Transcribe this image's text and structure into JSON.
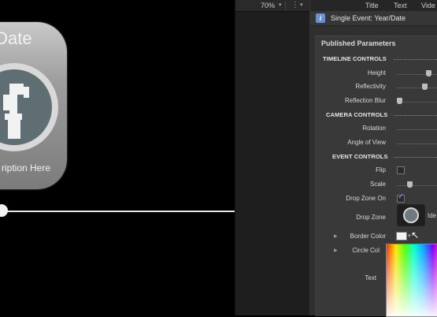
{
  "viewer": {
    "card_title": "/Date",
    "card_description": "ription Here"
  },
  "toolbar": {
    "zoom": "70%",
    "zoom_caret": "▾",
    "view_options_glyph": "⋮",
    "view_options_caret": "▾"
  },
  "inspector": {
    "tabs": [
      "Title",
      "Text",
      "Vide"
    ],
    "header_title": "Single Event: Year/Date",
    "panel_title": "Published Parameters",
    "sections": {
      "timeline": "TIMELINE CONTROLS",
      "camera": "CAMERA CONTROLS",
      "event": "EVENT CONTROLS"
    },
    "params": {
      "height": "Height",
      "reflectivity": "Reflectivity",
      "reflection_blur": "Reflection Blur",
      "rotation": "Rotation",
      "angle_of_view": "Angle of View",
      "flip": "Flip",
      "scale": "Scale",
      "drop_zone_on": "Drop Zone On",
      "drop_zone": "Drop Zone",
      "drop_zone_right": "Ide",
      "border_color": "Border Color",
      "circle_color": "Circle Col",
      "text_label": "Text"
    },
    "values": {
      "flip_checked": false,
      "drop_zone_on_checked": true
    }
  },
  "icons": {
    "info": "info-icon",
    "disclosure": "disclosure-triangle-icon",
    "cursor": "mouse-pointer-icon"
  }
}
